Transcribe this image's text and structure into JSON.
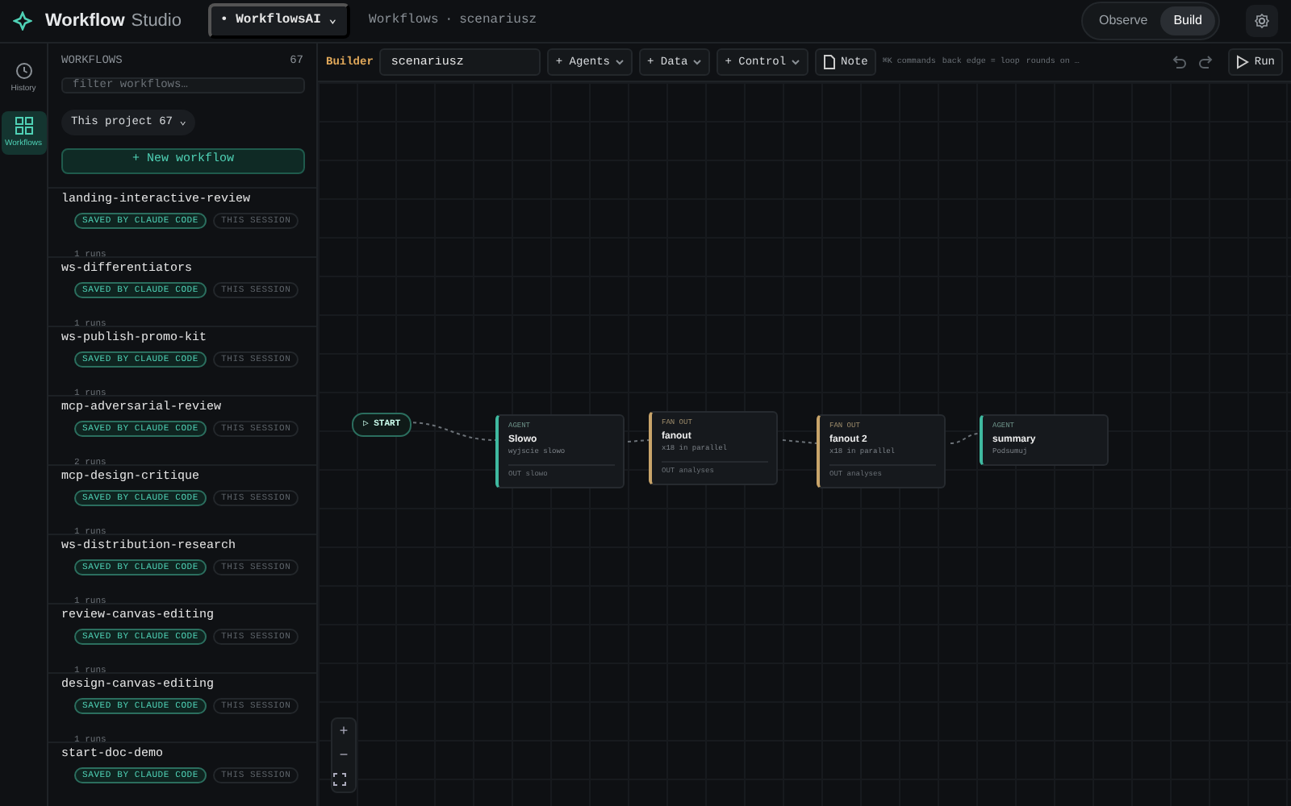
{
  "app": {
    "title": "Workflow",
    "subtitle": "Studio",
    "project_dot": "•",
    "project": "WorkflowsAI",
    "project_caret": "⌄"
  },
  "breadcrumb": [
    "Workflows",
    "scenariusz"
  ],
  "breadcrumb_separator": "·",
  "modes": [
    {
      "label": "Observe",
      "selected": false
    },
    {
      "label": "Build",
      "selected": true
    }
  ],
  "rail": [
    {
      "label": "History",
      "kind": "history",
      "selected": false
    },
    {
      "label": "Workflows",
      "kind": "grid",
      "selected": true
    }
  ],
  "sidebar": {
    "heading": "WORKFLOWS",
    "count": "67",
    "filter_placeholder": "filter workflows…",
    "scope": "This project 67 ⌄",
    "new_button": "+ New workflow",
    "items": [
      {
        "name": "landing-interactive-review",
        "badges": [
          "SAVED BY CLAUDE CODE",
          "THIS SESSION"
        ],
        "runs": "1 runs"
      },
      {
        "name": "ws-differentiators",
        "badges": [
          "SAVED BY CLAUDE CODE",
          "THIS SESSION"
        ],
        "runs": "1 runs"
      },
      {
        "name": "ws-publish-promo-kit",
        "badges": [
          "SAVED BY CLAUDE CODE",
          "THIS SESSION"
        ],
        "runs": "1 runs"
      },
      {
        "name": "mcp-adversarial-review",
        "badges": [
          "SAVED BY CLAUDE CODE",
          "THIS SESSION"
        ],
        "runs": "2 runs"
      },
      {
        "name": "mcp-design-critique",
        "badges": [
          "SAVED BY CLAUDE CODE",
          "THIS SESSION"
        ],
        "runs": "1 runs"
      },
      {
        "name": "ws-distribution-research",
        "badges": [
          "SAVED BY CLAUDE CODE",
          "THIS SESSION"
        ],
        "runs": "1 runs"
      },
      {
        "name": "review-canvas-editing",
        "badges": [
          "SAVED BY CLAUDE CODE",
          "THIS SESSION"
        ],
        "runs": "1 runs"
      },
      {
        "name": "design-canvas-editing",
        "badges": [
          "SAVED BY CLAUDE CODE",
          "THIS SESSION"
        ],
        "runs": "1 runs"
      },
      {
        "name": "start-doc-demo",
        "badges": [
          "SAVED BY CLAUDE CODE",
          "THIS SESSION"
        ]
      }
    ]
  },
  "toolbar": {
    "mode_label": "Builder",
    "name_value": "scenariusz",
    "menus": [
      "+ Agents",
      "+ Data",
      "+ Control"
    ],
    "note": "Note",
    "hints": [
      "⌘K commands",
      "back edge = loop",
      "rounds on …"
    ],
    "run": "Run"
  },
  "canvas": {
    "start_icon": "▷",
    "start": "START",
    "nodes": [
      {
        "kind": "agent",
        "tag": "AGENT",
        "title": "Slowo",
        "detail": "wyjscie slowo",
        "output": "OUT slowo"
      },
      {
        "kind": "fanout",
        "tag": "FAN OUT",
        "title": "fanout",
        "detail": "x18 in parallel",
        "output": "OUT analyses"
      },
      {
        "kind": "fanout",
        "tag": "FAN OUT",
        "title": "fanout 2",
        "detail": "x18 in parallel",
        "output": "OUT analyses"
      },
      {
        "kind": "agent",
        "tag": "AGENT",
        "title": "summary",
        "detail": "Podsumuj"
      }
    ]
  },
  "zoom": [
    "+",
    "−"
  ]
}
